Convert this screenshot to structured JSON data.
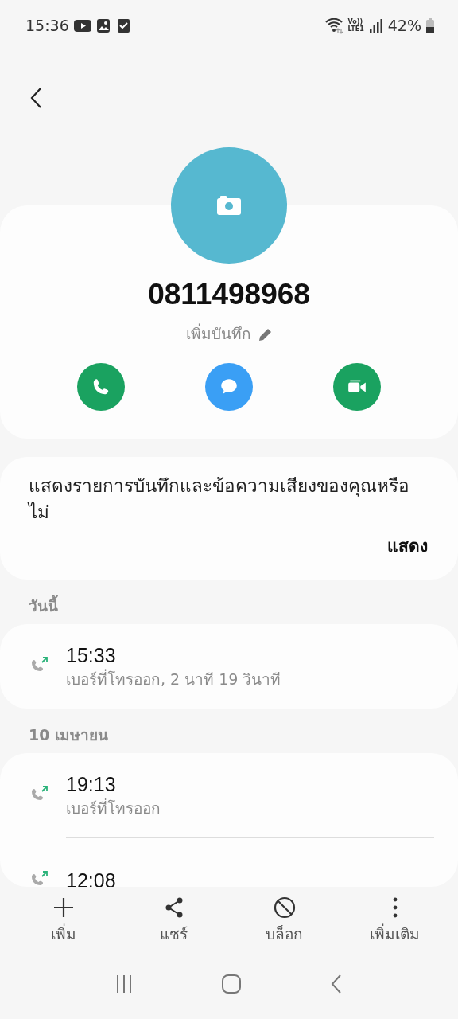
{
  "status_bar": {
    "time": "15:36",
    "network_top": "Vo))",
    "network_bottom": "LTE1",
    "battery": "42%"
  },
  "contact": {
    "number": "0811498968",
    "note_action": "เพิ่มบันทึก",
    "actions": [
      {
        "kind": "call",
        "color": "#1aa260"
      },
      {
        "kind": "message",
        "color": "#3a9ff5"
      },
      {
        "kind": "video",
        "color": "#1aa260"
      }
    ]
  },
  "notice": {
    "text": "แสดงรายการบันทึกและข้อความเสียงของคุณหรือไม่",
    "button": "แสดง"
  },
  "call_groups": [
    {
      "date": "วันนี้",
      "calls": [
        {
          "time": "15:33",
          "detail": "เบอร์ที่โทรออก, 2 นาที 19 วินาที",
          "kind": "outgoing"
        }
      ]
    },
    {
      "date": "10 เมษายน",
      "calls": [
        {
          "time": "19:13",
          "detail": "เบอร์ที่โทรออก",
          "kind": "outgoing"
        },
        {
          "time": "12:08",
          "kind": "outgoing"
        }
      ]
    }
  ],
  "bottom_actions": [
    {
      "kind": "add",
      "label": "เพิ่ม"
    },
    {
      "kind": "share",
      "label": "แชร์"
    },
    {
      "kind": "block",
      "label": "บล็อก"
    },
    {
      "kind": "more",
      "label": "เพิ่มเติม"
    }
  ]
}
